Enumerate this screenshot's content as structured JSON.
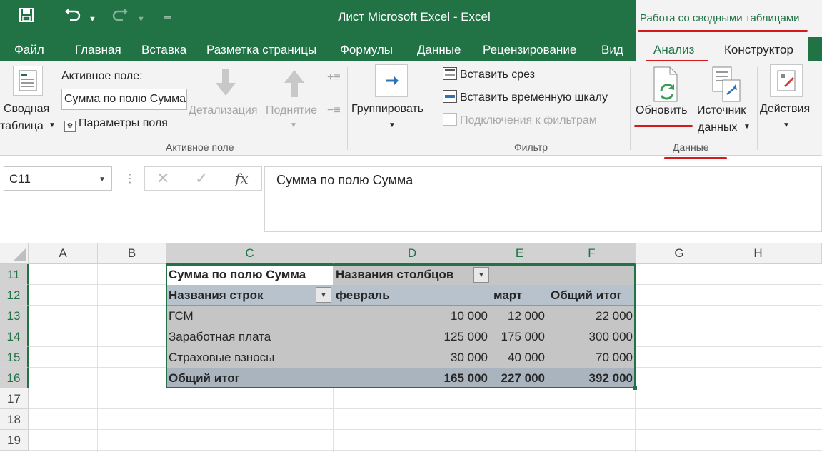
{
  "window": {
    "title": "Лист Microsoft Excel - Excel",
    "context_tools": "Работа со сводными таблицами"
  },
  "tabs": [
    "Файл",
    "Главная",
    "Вставка",
    "Разметка страницы",
    "Формулы",
    "Данные",
    "Рецензирование",
    "Вид"
  ],
  "context_tabs": {
    "analyze": "Анализ",
    "constructor": "Конструктор"
  },
  "ribbon": {
    "pivot_table": {
      "line1": "Сводная",
      "line2": "таблица"
    },
    "active_field": {
      "label": "Активное поле:",
      "value": "Сумма по полю Сумма",
      "field_params": "Параметры поля",
      "drill_down": "Детализация",
      "drill_up": "Поднятие",
      "group_label": "Активное поле"
    },
    "group": {
      "label": "Группировать"
    },
    "filter": {
      "insert_slicer": "Вставить срез",
      "insert_timeline": "Вставить временную шкалу",
      "filter_connections": "Подключения к фильтрам",
      "group_label": "Фильтр"
    },
    "data": {
      "refresh": "Обновить",
      "source_line1": "Источник",
      "source_line2": "данных",
      "group_label": "Данные"
    },
    "actions": {
      "label": "Действия"
    }
  },
  "formula_bar": {
    "name_box": "C11",
    "fx": "fx",
    "formula": "Сумма по полю Сумма"
  },
  "sheet": {
    "columns": [
      "A",
      "B",
      "C",
      "D",
      "E",
      "F",
      "G",
      "H"
    ],
    "rows": [
      "11",
      "12",
      "13",
      "14",
      "15",
      "16",
      "17",
      "18",
      "19"
    ],
    "pivot": {
      "title": "Сумма по полю Сумма",
      "col_header": "Названия столбцов",
      "row_header": "Названия строк",
      "col_labels": [
        "февраль",
        "март",
        "Общий итог"
      ],
      "rows": [
        {
          "label": "ГСМ",
          "values": [
            "10 000",
            "12 000",
            "22 000"
          ]
        },
        {
          "label": "Заработная плата",
          "values": [
            "125 000",
            "175 000",
            "300 000"
          ]
        },
        {
          "label": "Страховые взносы",
          "values": [
            "30 000",
            "40 000",
            "70 000"
          ]
        }
      ],
      "total": {
        "label": "Общий итог",
        "values": [
          "165 000",
          "227 000",
          "392 000"
        ]
      }
    }
  }
}
